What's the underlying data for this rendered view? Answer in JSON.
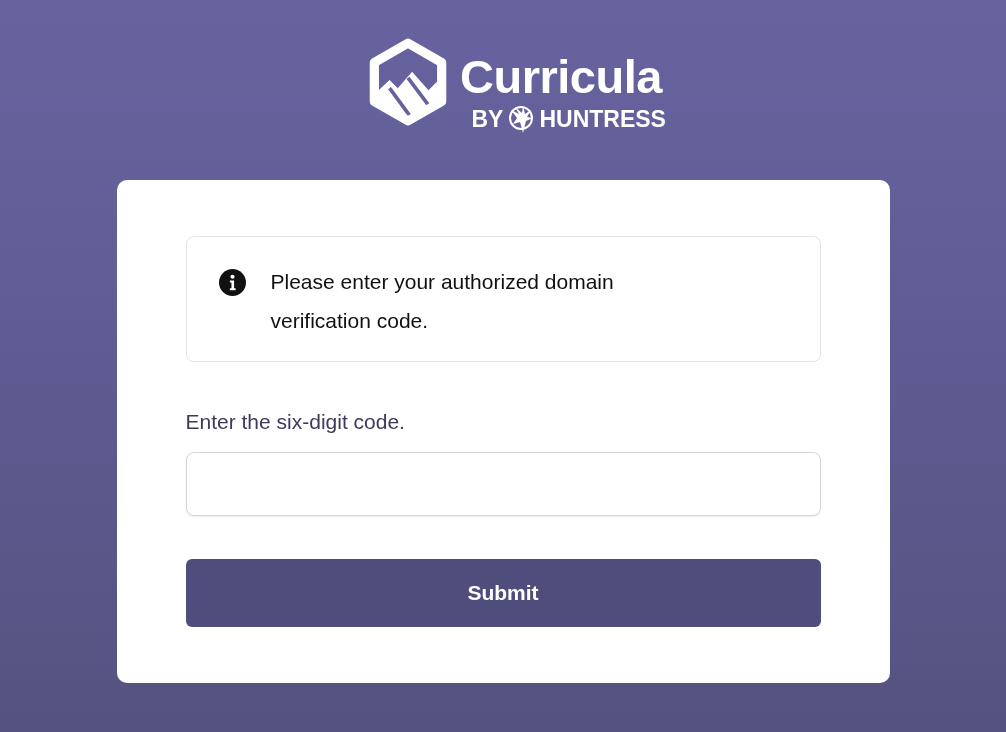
{
  "brand": {
    "name": "Curricula",
    "by": "BY",
    "company": "HUNTRESS"
  },
  "alert": {
    "message": "Please enter your authorized domain verification code."
  },
  "form": {
    "label": "Enter the six-digit code.",
    "submit": "Submit"
  }
}
